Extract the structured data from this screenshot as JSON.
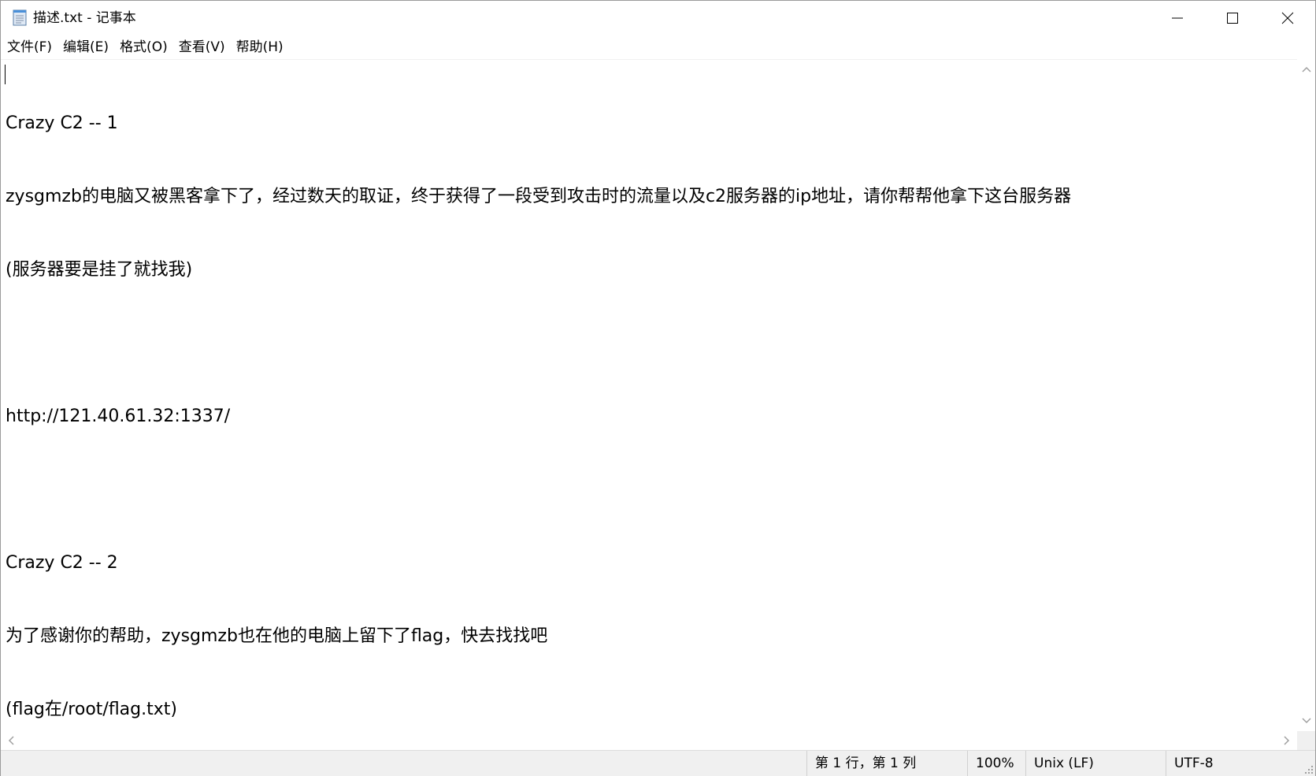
{
  "window": {
    "title": "描述.txt - 记事本",
    "icon": "notepad-icon",
    "controls": {
      "minimize_icon": "minimize-icon",
      "maximize_icon": "maximize-icon",
      "close_icon": "close-icon"
    }
  },
  "menubar": {
    "items": [
      {
        "label": "文件(F)"
      },
      {
        "label": "编辑(E)"
      },
      {
        "label": "格式(O)"
      },
      {
        "label": "查看(V)"
      },
      {
        "label": "帮助(H)"
      }
    ]
  },
  "editor": {
    "lines": [
      "Crazy C2 -- 1",
      "zysgmzb的电脑又被黑客拿下了，经过数天的取证，终于获得了一段受到攻击时的流量以及c2服务器的ip地址，请你帮帮他拿下这台服务器",
      "(服务器要是挂了就找我)",
      "",
      "http://121.40.61.32:1337/",
      "",
      "Crazy C2 -- 2",
      "为了感谢你的帮助，zysgmzb也在他的电脑上留下了flag，快去找找吧",
      "(flag在/root/flag.txt)"
    ]
  },
  "statusbar": {
    "position": "第 1 行，第 1 列",
    "zoom": "100%",
    "line_ending": "Unix (LF)",
    "encoding": "UTF-8"
  },
  "colors": {
    "background": "#ffffff",
    "statusbar_bg": "#f0f0f0",
    "text": "#000000"
  }
}
